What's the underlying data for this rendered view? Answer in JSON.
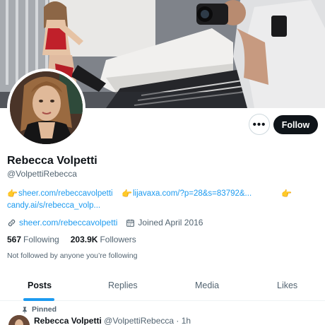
{
  "profile": {
    "name": "Rebecca Volpetti",
    "handle": "@VolpettiRebecca",
    "follow_label": "Follow",
    "more_label": "•••"
  },
  "bio": {
    "emoji": "👉",
    "link1": "sheer.com/rebeccavolpetti",
    "link2": "lijavaxa.com/?p=28&s=83792&...",
    "link3": "candy.ai/s/rebecca_volp..."
  },
  "meta": {
    "website": "sheer.com/rebeccavolpetti",
    "joined": "Joined April 2016"
  },
  "stats": {
    "following_count": "567",
    "following_label": "Following",
    "followers_count": "203.9K",
    "followers_label": "Followers"
  },
  "not_followed_text": "Not followed by anyone you’re following",
  "tabs": [
    {
      "label": "Posts",
      "active": true
    },
    {
      "label": "Replies",
      "active": false
    },
    {
      "label": "Media",
      "active": false
    },
    {
      "label": "Likes",
      "active": false
    }
  ],
  "pinned_post": {
    "pinned_label": "Pinned",
    "author_name": "Rebecca Volpetti",
    "author_handle": "@VolpettiRebecca",
    "separator": "·",
    "time": "1h"
  },
  "colors": {
    "accent": "#1d9bf0",
    "text_primary": "#0f1419",
    "text_secondary": "#536471",
    "button_dark": "#0f1419"
  },
  "icons": {
    "more": "more-dots-icon",
    "link": "link-icon",
    "calendar": "calendar-icon",
    "pin": "pin-icon"
  }
}
